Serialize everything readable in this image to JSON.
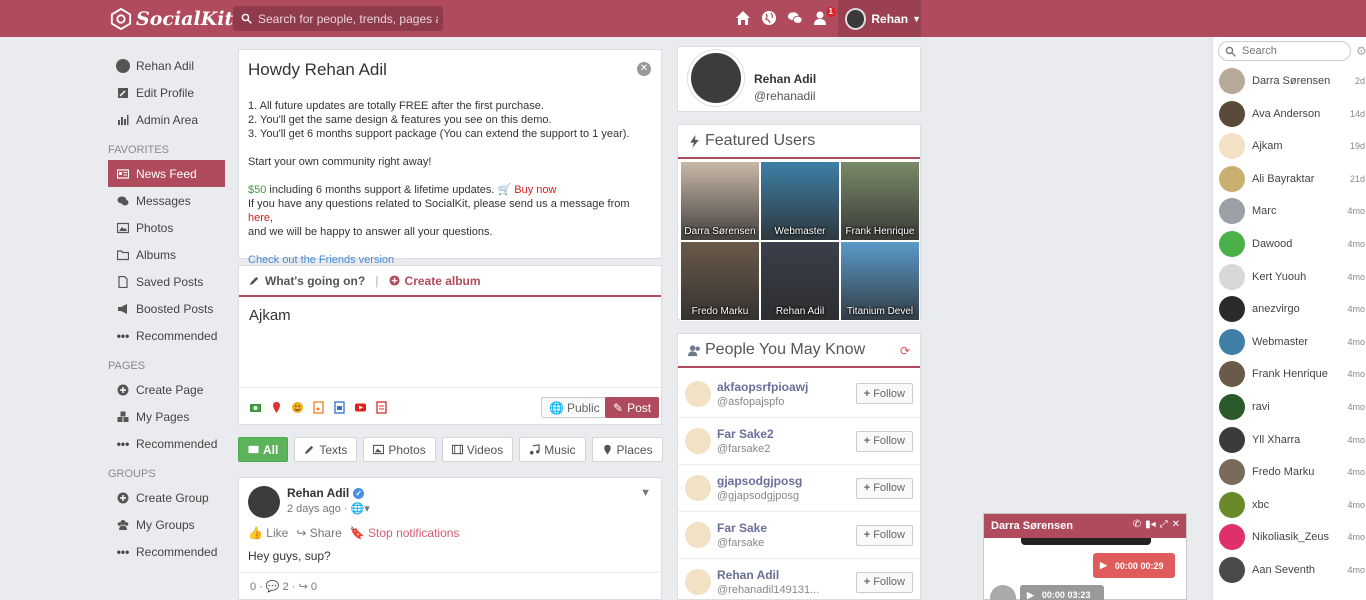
{
  "brand": "SocialKit",
  "search": {
    "placeholder": "Search for people, trends, pages and..."
  },
  "topbar": {
    "notification_count": "1",
    "user_name": "Rehan"
  },
  "leftnav": {
    "profile_name": "Rehan Adil",
    "edit_profile": "Edit Profile",
    "admin_area": "Admin Area",
    "favorites_head": "FAVORITES",
    "news_feed": "News Feed",
    "messages": "Messages",
    "photos": "Photos",
    "albums": "Albums",
    "saved_posts": "Saved Posts",
    "boosted_posts": "Boosted Posts",
    "recommended1": "Recommended",
    "pages_head": "PAGES",
    "create_page": "Create Page",
    "my_pages": "My Pages",
    "recommended2": "Recommended",
    "groups_head": "GROUPS",
    "create_group": "Create Group",
    "my_groups": "My Groups",
    "recommended3": "Recommended"
  },
  "welcome": {
    "title": "Howdy Rehan Adil",
    "line1": "1. All future updates are totally FREE after the first purchase.",
    "line2": "2. You'll get the same design & features you see on this demo.",
    "line3": "3. You'll get 6 months support package (You can extend the support to 1 year).",
    "start": "Start your own community right away!",
    "price": "$50",
    "price_text": " including 6 months support & lifetime updates. ",
    "buy_now": "Buy now",
    "questions": "If you have any questions related to SocialKit, please send us a message from ",
    "here": "here",
    "comma": ",",
    "happy": "and we will be happy to answer all your questions.",
    "friends_link": "Check out the Friends version"
  },
  "composer": {
    "whats_going_on": "What's going on?",
    "create_album": "Create album",
    "text": "Ajkam",
    "public": "Public",
    "post": "Post"
  },
  "filters": {
    "all": "All",
    "texts": "Texts",
    "photos": "Photos",
    "videos": "Videos",
    "music": "Music",
    "places": "Places"
  },
  "post": {
    "author": "Rehan Adil",
    "time": "2 days ago · ",
    "like": "Like",
    "share": "Share",
    "stop": "Stop notifications",
    "body": "Hey guys, sup?",
    "likes_count": "0",
    "comments_count": "2",
    "shares_count": "0"
  },
  "profile_card": {
    "name": "Rehan Adil",
    "handle": "@rehanadil"
  },
  "featured": {
    "title": "Featured Users",
    "users": [
      {
        "name": "Darra Sørensen",
        "color": "#c9b8a8"
      },
      {
        "name": "Webmaster",
        "color": "#3f7fa6"
      },
      {
        "name": "Frank Henrique",
        "color": "#7a8a6a"
      },
      {
        "name": "Fredo Marku",
        "color": "#6a5a4a"
      },
      {
        "name": "Rehan Adil",
        "color": "#3a3f4a"
      },
      {
        "name": "Titanium Devel",
        "color": "#5a9ac8"
      }
    ]
  },
  "pymk": {
    "title": "People You May Know",
    "follow": "Follow",
    "people": [
      {
        "name": "akfaopsrfpioawj",
        "handle": "@asfopajspfo"
      },
      {
        "name": "Far Sake2",
        "handle": "@farsake2"
      },
      {
        "name": "gjapsodgjposg",
        "handle": "@gjapsodgjposg"
      },
      {
        "name": "Far Sake",
        "handle": "@farsake"
      },
      {
        "name": "Rehan Adil",
        "handle": "@rehanadil149131..."
      }
    ]
  },
  "chat": {
    "search_placeholder": "Search",
    "contacts": [
      {
        "name": "Darra Sørensen",
        "time": "2d",
        "color": "#b7a999"
      },
      {
        "name": "Ava Anderson",
        "time": "14d",
        "color": "#5a4a3a"
      },
      {
        "name": "Ajkam",
        "time": "19d",
        "color": "#f3e1c6"
      },
      {
        "name": "Ali Bayraktar",
        "time": "21d",
        "color": "#c8b070"
      },
      {
        "name": "Marc",
        "time": "4mo",
        "color": "#9aa0a6"
      },
      {
        "name": "Dawood",
        "time": "4mo",
        "color": "#4ab04a"
      },
      {
        "name": "Kert Yuouh",
        "time": "4mo",
        "color": "#d8d8d8"
      },
      {
        "name": "anezvirgo",
        "time": "4mo",
        "color": "#2a2a2a"
      },
      {
        "name": "Webmaster",
        "time": "4mo",
        "color": "#3f7fa6"
      },
      {
        "name": "Frank Henrique",
        "time": "4mo",
        "color": "#6a5a4a"
      },
      {
        "name": "ravi",
        "time": "4mo",
        "color": "#2a5a2a"
      },
      {
        "name": "Yll Xharra",
        "time": "4mo",
        "color": "#3a3a3a"
      },
      {
        "name": "Fredo Marku",
        "time": "4mo",
        "color": "#7a6a5a"
      },
      {
        "name": "xbc",
        "time": "4mo",
        "color": "#6a8a2a"
      },
      {
        "name": "Nikoliasik_Zeus",
        "time": "4mo",
        "color": "#e0306a"
      },
      {
        "name": "Aan Seventh",
        "time": "4mo",
        "color": "#4a4a4a"
      }
    ]
  },
  "chatwin": {
    "name": "Darra Sørensen",
    "audio1": "00:00  00:29",
    "audio2": "00:00  03:23"
  },
  "colors": {
    "brand": "#b04b5d",
    "green": "#5cb35c",
    "link": "#4a8bd0"
  }
}
